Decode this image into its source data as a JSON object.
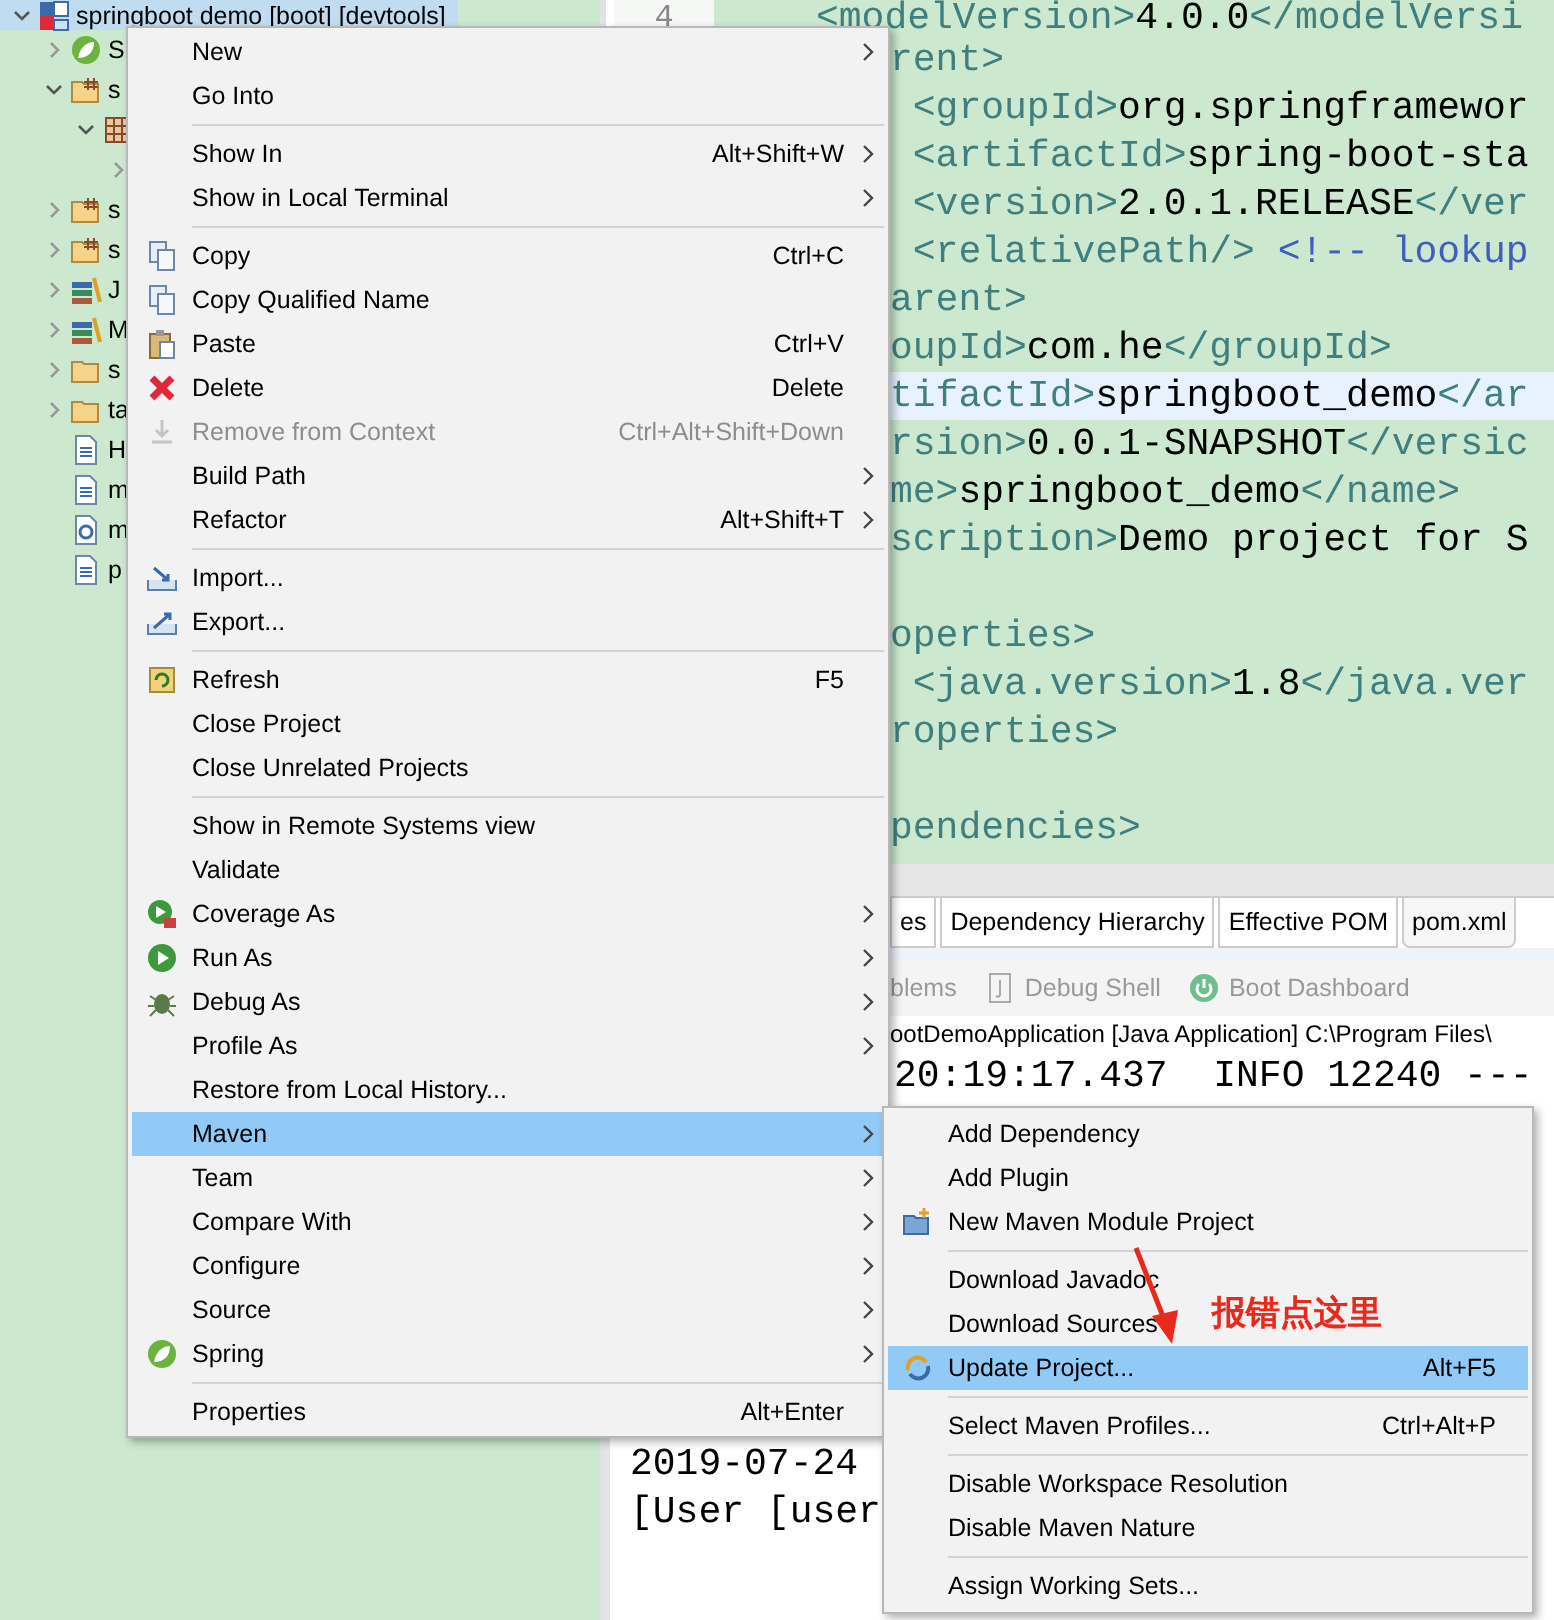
{
  "tree": {
    "items": [
      {
        "label": "springboot demo [boot] [devtools]",
        "kind": "project",
        "expanded": true,
        "selected": true,
        "children": [
          {
            "label": "S",
            "kind": "leaf",
            "expanded": false,
            "selected": false
          },
          {
            "label": "s",
            "kind": "package-folder",
            "expanded": true,
            "selected": false,
            "children": [
              {
                "kind": "package",
                "expanded": true,
                "selected": false,
                "children": [
                  {
                    "expanded": false,
                    "selected": false
                  }
                ]
              }
            ]
          },
          {
            "label": "s",
            "kind": "package-folder",
            "expanded": false,
            "selected": false
          },
          {
            "label": "s",
            "kind": "package-folder",
            "expanded": false,
            "selected": false
          },
          {
            "label": "J",
            "kind": "books",
            "expanded": false,
            "selected": false
          },
          {
            "label": "M",
            "kind": "books",
            "expanded": false,
            "selected": false
          },
          {
            "label": "s",
            "kind": "folder",
            "expanded": false,
            "selected": false
          },
          {
            "label": "ta",
            "kind": "folder",
            "expanded": false,
            "selected": false
          },
          {
            "label": "H",
            "kind": "document",
            "selected": false
          },
          {
            "label": "m",
            "kind": "document",
            "selected": false
          },
          {
            "label": "m",
            "kind": "document-gear",
            "selected": false
          },
          {
            "label": "p",
            "kind": "document",
            "selected": false
          }
        ]
      }
    ]
  },
  "editor": {
    "line_number": "4",
    "lines": [
      {
        "current": false,
        "parts": [
          {
            "kind": "tag",
            "text": "<modelVersion>"
          },
          {
            "kind": "text",
            "text": "4.0.0"
          },
          {
            "kind": "tag",
            "text": "</modelVersi"
          }
        ]
      },
      {
        "current": false,
        "parts": [
          {
            "kind": "tag",
            "text": "rent>"
          }
        ]
      },
      {
        "current": false,
        "parts": [
          {
            "kind": "tag",
            "text": " <groupId>"
          },
          {
            "kind": "text",
            "text": "org.springframewor"
          }
        ]
      },
      {
        "current": false,
        "parts": [
          {
            "kind": "tag",
            "text": " <artifactId>"
          },
          {
            "kind": "text",
            "text": "spring-boot-sta"
          }
        ]
      },
      {
        "current": false,
        "parts": [
          {
            "kind": "tag",
            "text": " <version>"
          },
          {
            "kind": "text",
            "text": "2.0.1.RELEASE"
          },
          {
            "kind": "tag",
            "text": "</ver"
          }
        ]
      },
      {
        "current": false,
        "parts": [
          {
            "kind": "tag",
            "text": " <relativePath/>"
          },
          {
            "kind": "comment",
            "text": " <!-- lookup"
          }
        ]
      },
      {
        "current": false,
        "parts": [
          {
            "kind": "tag",
            "text": "arent>"
          }
        ]
      },
      {
        "current": false,
        "parts": [
          {
            "kind": "tag",
            "text": "oupId>"
          },
          {
            "kind": "text",
            "text": "com.he"
          },
          {
            "kind": "tag",
            "text": "</groupId>"
          }
        ]
      },
      {
        "current": true,
        "parts": [
          {
            "kind": "tag",
            "text": "tifactId>"
          },
          {
            "kind": "text",
            "text": "springboot_demo"
          },
          {
            "kind": "tag",
            "text": "</ar"
          }
        ]
      },
      {
        "current": false,
        "parts": [
          {
            "kind": "tag",
            "text": "rsion>"
          },
          {
            "kind": "text",
            "text": "0.0.1-SNAPSHOT"
          },
          {
            "kind": "tag",
            "text": "</versic"
          }
        ]
      },
      {
        "current": false,
        "parts": [
          {
            "kind": "tag",
            "text": "me>"
          },
          {
            "kind": "text",
            "text": "springboot_demo"
          },
          {
            "kind": "tag",
            "text": "</name>"
          }
        ]
      },
      {
        "current": false,
        "parts": [
          {
            "kind": "tag",
            "text": "scription>"
          },
          {
            "kind": "text",
            "text": "Demo project for S"
          }
        ]
      },
      {
        "current": false
      },
      {
        "current": false,
        "parts": [
          {
            "kind": "tag",
            "text": "operties>"
          }
        ]
      },
      {
        "current": false,
        "parts": [
          {
            "kind": "tag",
            "text": " <java.version>"
          },
          {
            "kind": "text",
            "text": "1.8"
          },
          {
            "kind": "tag",
            "text": "</java.ver"
          }
        ]
      },
      {
        "current": false,
        "parts": [
          {
            "kind": "tag",
            "text": "roperties>"
          }
        ]
      },
      {
        "current": false
      },
      {
        "current": false,
        "parts": [
          {
            "kind": "tag",
            "text": "pendencies>"
          }
        ]
      }
    ]
  },
  "bottom_tabs": [
    {
      "label": "es",
      "selected": false
    },
    {
      "label": "Dependency Hierarchy",
      "selected": false
    },
    {
      "label": "Effective POM",
      "selected": false
    },
    {
      "label": "pom.xml",
      "selected": true
    }
  ],
  "views": [
    {
      "label": "blems",
      "kind": "plain"
    },
    {
      "label": "Debug Shell",
      "kind": "shell"
    },
    {
      "label": "Boot Dashboard",
      "kind": "power"
    }
  ],
  "console": {
    "header": "ootDemoApplication [Java Application] C:\\Program Files\\",
    "lines": [
      {
        "kind": "partial",
        "text": "20:19:17.437  INFO 12240 ---"
      },
      {
        "kind": "full",
        "text": "2019-07-24"
      },
      {
        "kind": "full",
        "text": "[User [user"
      }
    ]
  },
  "context_menu": {
    "groups": [
      [
        {
          "label": "New",
          "kind": "plain",
          "submenu": true,
          "selected": false,
          "disabled": false
        },
        {
          "label": "Go Into",
          "kind": "plain",
          "submenu": false,
          "selected": false,
          "disabled": false
        }
      ],
      [
        {
          "label": "Show In",
          "shortcut": "Alt+Shift+W",
          "kind": "plain",
          "submenu": true,
          "selected": false,
          "disabled": false
        },
        {
          "label": "Show in Local Terminal",
          "kind": "plain",
          "submenu": true,
          "selected": false,
          "disabled": false
        }
      ],
      [
        {
          "label": "Copy",
          "shortcut": "Ctrl+C",
          "kind": "copy",
          "submenu": false,
          "selected": false,
          "disabled": false
        },
        {
          "label": "Copy Qualified Name",
          "kind": "copy",
          "submenu": false,
          "selected": false,
          "disabled": false
        },
        {
          "label": "Paste",
          "shortcut": "Ctrl+V",
          "kind": "paste",
          "submenu": false,
          "selected": false,
          "disabled": false
        },
        {
          "label": "Delete",
          "shortcut": "Delete",
          "kind": "delete",
          "submenu": false,
          "selected": false,
          "disabled": false
        },
        {
          "label": "Remove from Context",
          "shortcut": "Ctrl+Alt+Shift+Down",
          "kind": "remove",
          "submenu": false,
          "selected": false,
          "disabled": true
        },
        {
          "label": "Build Path",
          "kind": "plain",
          "submenu": true,
          "selected": false,
          "disabled": false
        },
        {
          "label": "Refactor",
          "shortcut": "Alt+Shift+T",
          "kind": "plain",
          "submenu": true,
          "selected": false,
          "disabled": false
        }
      ],
      [
        {
          "label": "Import...",
          "kind": "import",
          "submenu": false,
          "selected": false,
          "disabled": false
        },
        {
          "label": "Export...",
          "kind": "export",
          "submenu": false,
          "selected": false,
          "disabled": false
        }
      ],
      [
        {
          "label": "Refresh",
          "shortcut": "F5",
          "kind": "refresh",
          "submenu": false,
          "selected": false,
          "disabled": false
        },
        {
          "label": "Close Project",
          "kind": "plain",
          "submenu": false,
          "selected": false,
          "disabled": false
        },
        {
          "label": "Close Unrelated Projects",
          "kind": "plain",
          "submenu": false,
          "selected": false,
          "disabled": false
        }
      ],
      [
        {
          "label": "Show in Remote Systems view",
          "kind": "plain",
          "submenu": false,
          "selected": false,
          "disabled": false
        },
        {
          "label": "Validate",
          "kind": "plain",
          "submenu": false,
          "selected": false,
          "disabled": false
        },
        {
          "label": "Coverage As",
          "kind": "coverage",
          "submenu": true,
          "selected": false,
          "disabled": false
        },
        {
          "label": "Run As",
          "kind": "run",
          "submenu": true,
          "selected": false,
          "disabled": false
        },
        {
          "label": "Debug As",
          "kind": "debug",
          "submenu": true,
          "selected": false,
          "disabled": false
        },
        {
          "label": "Profile As",
          "kind": "plain",
          "submenu": true,
          "selected": false,
          "disabled": false
        },
        {
          "label": "Restore from Local History...",
          "kind": "plain",
          "submenu": false,
          "selected": false,
          "disabled": false
        },
        {
          "label": "Maven",
          "kind": "plain",
          "submenu": true,
          "selected": true,
          "disabled": false
        },
        {
          "label": "Team",
          "kind": "plain",
          "submenu": true,
          "selected": false,
          "disabled": false
        },
        {
          "label": "Compare With",
          "kind": "plain",
          "submenu": true,
          "selected": false,
          "disabled": false
        },
        {
          "label": "Configure",
          "kind": "plain",
          "submenu": true,
          "selected": false,
          "disabled": false
        },
        {
          "label": "Source",
          "kind": "plain",
          "submenu": true,
          "selected": false,
          "disabled": false
        },
        {
          "label": "Spring",
          "kind": "spring",
          "submenu": true,
          "selected": false,
          "disabled": false
        }
      ],
      [
        {
          "label": "Properties",
          "shortcut": "Alt+Enter",
          "kind": "plain",
          "submenu": false,
          "selected": false,
          "disabled": false
        }
      ]
    ]
  },
  "submenu": {
    "groups": [
      [
        {
          "label": "Add Dependency",
          "kind": "plain",
          "selected": false
        },
        {
          "label": "Add Plugin",
          "kind": "plain",
          "selected": false
        },
        {
          "label": "New Maven Module Project",
          "kind": "new-module",
          "selected": false
        }
      ],
      [
        {
          "label": "Download Javadoc",
          "kind": "plain",
          "selected": false
        },
        {
          "label": "Download Sources",
          "kind": "plain",
          "selected": false
        },
        {
          "label": "Update Project...",
          "shortcut": "Alt+F5",
          "kind": "update",
          "selected": true
        }
      ],
      [
        {
          "label": "Select Maven Profiles...",
          "shortcut": "Ctrl+Alt+P",
          "kind": "plain",
          "selected": false
        }
      ],
      [
        {
          "label": "Disable Workspace Resolution",
          "kind": "plain",
          "selected": false
        },
        {
          "label": "Disable Maven Nature",
          "kind": "plain",
          "selected": false
        }
      ],
      [
        {
          "label": "Assign Working Sets...",
          "kind": "plain",
          "selected": false
        }
      ]
    ]
  },
  "annotation": {
    "text": "报错点这里"
  }
}
